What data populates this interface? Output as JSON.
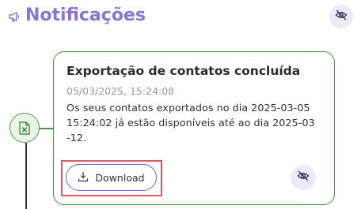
{
  "header": {
    "title": "Notificações",
    "title_icon": "megaphone-icon",
    "hide_icon": "eye-off-icon"
  },
  "notification": {
    "file_icon": "excel-file-icon",
    "title": "Exportação de contatos concluída",
    "date": "05/03/2025, 15:24:08",
    "message": "Os seus contatos exportados no dia 2025-03-05 15:24:02 já estão disponíveis até ao dia 2025-03-12.",
    "download_label": "Download",
    "download_icon": "download-tray-icon",
    "hide_icon": "eye-off-icon"
  },
  "colors": {
    "accent": "#8a73d6",
    "card_border": "#4f8f4f",
    "button_border": "#6e63d8",
    "highlight": "#e05b63",
    "icon_bg": "#eeeafa",
    "badge_bg": "#e9f5e6"
  }
}
